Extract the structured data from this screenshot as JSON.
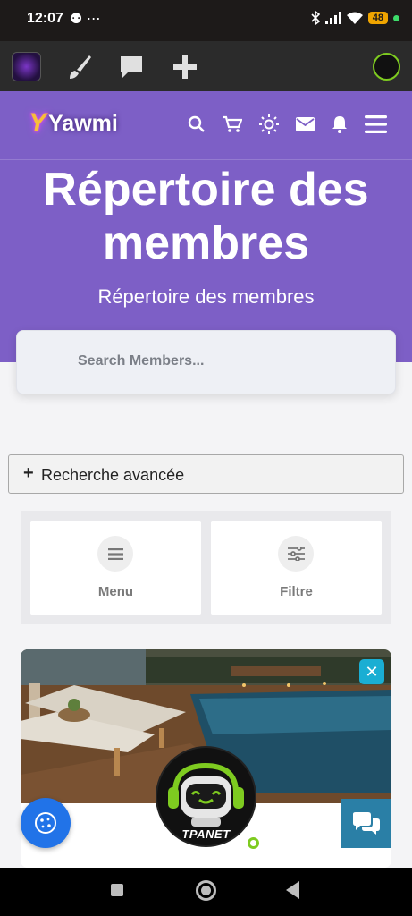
{
  "status": {
    "time": "12:07",
    "extra": "⚉ ⋯",
    "battery": "48"
  },
  "header": {
    "brand_initial": "Y",
    "brand_name": "Yawmi",
    "title": "Répertoire des membres",
    "subtitle": "Répertoire des membres"
  },
  "search": {
    "placeholder": "Search Members..."
  },
  "advanced": {
    "plus": "+",
    "label": "Recherche avancée"
  },
  "tiles": [
    {
      "label": "Menu",
      "icon": "hamburger-icon"
    },
    {
      "label": "Filtre",
      "icon": "sliders-icon"
    }
  ],
  "card": {
    "close": "✕"
  },
  "bot": {
    "label": "TPANET"
  },
  "colors": {
    "header_bg": "#7d5fc6",
    "fab_blue": "#2173e8",
    "chat_teal": "#2a7fa6",
    "close_cyan": "#1aaed3",
    "bot_green": "#7ecb20"
  }
}
